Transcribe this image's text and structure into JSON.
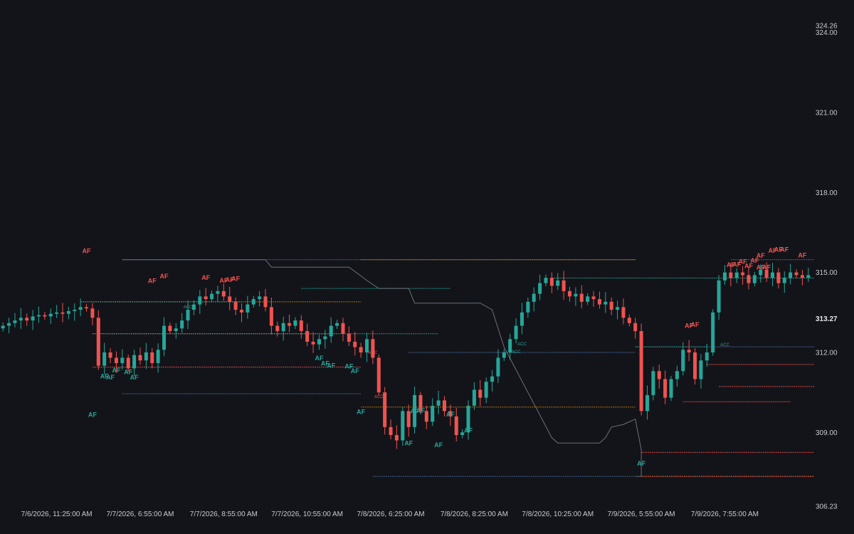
{
  "colors": {
    "background": "#131419",
    "up": "#26a69a",
    "down": "#ef5350",
    "orange": "#c87f0a",
    "blue": "#4a6fa5",
    "gray": "#6b6f78",
    "text": "#c7c9cf"
  },
  "chart_data": {
    "type": "candlestick",
    "title": "",
    "xlabel": "",
    "ylabel": "",
    "ylim": [
      306.23,
      324.26
    ],
    "y_axis": {
      "ticks": [
        "324.26",
        "324.00",
        "321.00",
        "318.00",
        "315.00",
        "312.00",
        "309.00",
        "306.23"
      ],
      "tick_values": [
        324.26,
        324.0,
        321.0,
        318.0,
        315.0,
        312.0,
        309.0,
        306.23
      ],
      "current_price": "313.27"
    },
    "x_axis": {
      "ticks": [
        "7/6/2026, 11:25:00 AM",
        "7/7/2026, 6:55:00 AM",
        "7/7/2026, 8:55:00 AM",
        "7/7/2026, 10:55:00 AM",
        "7/8/2026, 6:25:00 AM",
        "7/8/2026, 8:25:00 AM",
        "7/8/2026, 10:25:00 AM",
        "7/9/2026, 5:55:00 AM",
        "7/9/2026, 7:55:00 AM"
      ],
      "tick_bars": [
        9,
        23,
        37,
        51,
        65,
        79,
        93,
        107,
        121
      ]
    },
    "bar_count": 136,
    "closes": [
      313.0,
      313.1,
      313.2,
      313.3,
      313.2,
      313.35,
      313.4,
      313.35,
      313.45,
      313.5,
      313.45,
      313.55,
      313.6,
      313.7,
      313.65,
      313.3,
      311.5,
      312.0,
      311.8,
      311.6,
      311.8,
      311.4,
      311.9,
      311.7,
      312.0,
      311.6,
      312.1,
      313.0,
      312.8,
      312.9,
      313.2,
      313.6,
      313.8,
      314.1,
      314.0,
      314.2,
      314.3,
      314.1,
      313.9,
      313.6,
      313.5,
      313.8,
      314.0,
      314.1,
      313.7,
      313.0,
      312.8,
      313.1,
      313.0,
      313.2,
      312.8,
      312.4,
      312.3,
      312.5,
      312.6,
      313.0,
      313.1,
      312.7,
      312.4,
      312.2,
      312.0,
      312.5,
      311.8,
      310.5,
      309.2,
      308.9,
      308.7,
      309.8,
      309.2,
      310.4,
      309.8,
      309.4,
      310.0,
      310.2,
      309.8,
      309.6,
      308.9,
      309.0,
      310.0,
      310.6,
      310.3,
      310.9,
      311.1,
      311.8,
      312.0,
      312.5,
      313.0,
      313.5,
      313.9,
      314.2,
      314.6,
      314.8,
      314.5,
      314.7,
      314.3,
      314.1,
      314.2,
      313.9,
      314.1,
      314.0,
      313.8,
      313.9,
      313.6,
      313.7,
      313.3,
      313.1,
      312.8,
      309.8,
      310.4,
      311.3,
      311.0,
      310.3,
      311.0,
      311.3,
      312.1,
      312.0,
      311.0,
      311.7,
      312.0,
      313.5,
      314.7,
      315.0,
      314.8,
      315.0,
      314.9,
      314.6,
      314.9,
      315.1,
      314.8,
      315.0,
      314.6,
      314.8,
      315.0,
      314.9,
      314.8,
      314.9
    ],
    "levels": [
      {
        "price": 315.48,
        "from_bar": 20,
        "to_bar": 106,
        "color": "#4a6fa5"
      },
      {
        "price": 315.48,
        "from_bar": 60,
        "to_bar": 106,
        "color": "#c87f0a"
      },
      {
        "price": 315.48,
        "from_bar": 122,
        "to_bar": 136,
        "color": "#6b6f78"
      },
      {
        "price": 314.79,
        "from_bar": 92,
        "to_bar": 136,
        "color": "#26a69a"
      },
      {
        "price": 314.4,
        "from_bar": 50,
        "to_bar": 75,
        "color": "#26a69a"
      },
      {
        "price": 313.9,
        "from_bar": 13,
        "to_bar": 60,
        "color": "#c87f0a"
      },
      {
        "price": 313.9,
        "from_bar": 13,
        "to_bar": 40,
        "color": "#26a69a"
      },
      {
        "price": 312.7,
        "from_bar": 15,
        "to_bar": 56,
        "color": "#ef5350"
      },
      {
        "price": 312.7,
        "from_bar": 15,
        "to_bar": 73,
        "color": "#26a69a"
      },
      {
        "price": 312.21,
        "from_bar": 106,
        "to_bar": 136,
        "color": "#4a6fa5"
      },
      {
        "price": 312.21,
        "from_bar": 106,
        "to_bar": 118,
        "color": "#26a69a"
      },
      {
        "price": 312.0,
        "from_bar": 68,
        "to_bar": 106,
        "color": "#4a6fa5"
      },
      {
        "price": 311.55,
        "from_bar": 118,
        "to_bar": 136,
        "color": "#ef5350"
      },
      {
        "price": 311.45,
        "from_bar": 15,
        "to_bar": 60,
        "color": "#ef5350"
      },
      {
        "price": 310.72,
        "from_bar": 120,
        "to_bar": 136,
        "color": "#ef5350"
      },
      {
        "price": 310.15,
        "from_bar": 114,
        "to_bar": 132,
        "color": "#ef5350"
      },
      {
        "price": 310.45,
        "from_bar": 20,
        "to_bar": 60,
        "color": "#4a6fa5"
      },
      {
        "price": 309.95,
        "from_bar": 60,
        "to_bar": 106,
        "color": "#c87f0a"
      },
      {
        "price": 308.25,
        "from_bar": 107,
        "to_bar": 136,
        "color": "#ef5350"
      },
      {
        "price": 307.35,
        "from_bar": 62,
        "to_bar": 106,
        "color": "#4a6fa5"
      },
      {
        "price": 307.35,
        "from_bar": 107,
        "to_bar": 136,
        "color": "#c87f0a"
      },
      {
        "price": 307.35,
        "from_bar": 107,
        "to_bar": 136,
        "color": "#ef5350"
      }
    ],
    "step_line": {
      "color": "#6b6f78",
      "points": [
        [
          20,
          315.48
        ],
        [
          44,
          315.48
        ],
        [
          45,
          315.2
        ],
        [
          58,
          315.2
        ],
        [
          61,
          314.7
        ],
        [
          63,
          314.4
        ],
        [
          68,
          314.4
        ],
        [
          69,
          313.85
        ],
        [
          80,
          313.85
        ],
        [
          82,
          313.6
        ],
        [
          84,
          312.2
        ],
        [
          92,
          308.8
        ],
        [
          93,
          308.6
        ],
        [
          100,
          308.6
        ],
        [
          101,
          308.8
        ],
        [
          102,
          309.2
        ],
        [
          104,
          309.3
        ],
        [
          106,
          309.5
        ],
        [
          107,
          308.35
        ],
        [
          107,
          307.35
        ],
        [
          106,
          307.35
        ]
      ]
    },
    "annotations": [
      {
        "text": "AF",
        "bar": 14,
        "price": 315.72,
        "kind": "down"
      },
      {
        "text": "AF",
        "bar": 25,
        "price": 314.6,
        "kind": "down"
      },
      {
        "text": "AF",
        "bar": 27,
        "price": 314.78,
        "kind": "down"
      },
      {
        "text": "AF",
        "bar": 34,
        "price": 314.72,
        "kind": "down"
      },
      {
        "text": "AF",
        "bar": 37,
        "price": 314.62,
        "kind": "down"
      },
      {
        "text": "AF",
        "bar": 38,
        "price": 314.64,
        "kind": "down"
      },
      {
        "text": "AF",
        "bar": 39,
        "price": 314.68,
        "kind": "down"
      },
      {
        "text": "AF",
        "bar": 15,
        "price": 309.58,
        "kind": "up"
      },
      {
        "text": "AF",
        "bar": 17,
        "price": 311.03,
        "kind": "up"
      },
      {
        "text": "AF",
        "bar": 18,
        "price": 310.99,
        "kind": "up"
      },
      {
        "text": "AF",
        "bar": 19,
        "price": 311.25,
        "kind": "up"
      },
      {
        "text": "AF",
        "bar": 21,
        "price": 311.18,
        "kind": "up"
      },
      {
        "text": "AF",
        "bar": 22,
        "price": 310.98,
        "kind": "up"
      },
      {
        "text": "AF",
        "bar": 53,
        "price": 311.7,
        "kind": "up"
      },
      {
        "text": "AF",
        "bar": 54,
        "price": 311.5,
        "kind": "up"
      },
      {
        "text": "AF",
        "bar": 55,
        "price": 311.42,
        "kind": "up"
      },
      {
        "text": "AF",
        "bar": 58,
        "price": 311.4,
        "kind": "up"
      },
      {
        "text": "AF",
        "bar": 59,
        "price": 311.22,
        "kind": "up"
      },
      {
        "text": "AF",
        "bar": 60,
        "price": 309.69,
        "kind": "up"
      },
      {
        "text": "AF",
        "bar": 68,
        "price": 308.52,
        "kind": "up"
      },
      {
        "text": "AF",
        "bar": 69,
        "price": 309.71,
        "kind": "up"
      },
      {
        "text": "AF",
        "bar": 70,
        "price": 309.73,
        "kind": "up"
      },
      {
        "text": "AF",
        "bar": 73,
        "price": 308.45,
        "kind": "up"
      },
      {
        "text": "AF",
        "bar": 75,
        "price": 309.59,
        "kind": "up"
      },
      {
        "text": "AF",
        "bar": 78,
        "price": 309.0,
        "kind": "up"
      },
      {
        "text": "AF",
        "bar": 107,
        "price": 307.75,
        "kind": "up"
      },
      {
        "text": "AF",
        "bar": 115,
        "price": 312.92,
        "kind": "down"
      },
      {
        "text": "AF",
        "bar": 116,
        "price": 312.96,
        "kind": "down"
      },
      {
        "text": "AF",
        "bar": 122,
        "price": 315.2,
        "kind": "down"
      },
      {
        "text": "AF",
        "bar": 123,
        "price": 315.22,
        "kind": "down"
      },
      {
        "text": "AF",
        "bar": 124,
        "price": 315.33,
        "kind": "down"
      },
      {
        "text": "AF",
        "bar": 125,
        "price": 315.16,
        "kind": "down"
      },
      {
        "text": "AF",
        "bar": 126,
        "price": 315.36,
        "kind": "down"
      },
      {
        "text": "AF",
        "bar": 127,
        "price": 315.55,
        "kind": "down"
      },
      {
        "text": "AF",
        "bar": 127,
        "price": 315.11,
        "kind": "down"
      },
      {
        "text": "AF",
        "bar": 128,
        "price": 315.11,
        "kind": "down"
      },
      {
        "text": "AF",
        "bar": 129,
        "price": 315.74,
        "kind": "down"
      },
      {
        "text": "AF",
        "bar": 130,
        "price": 315.78,
        "kind": "down"
      },
      {
        "text": "AF",
        "bar": 131,
        "price": 315.78,
        "kind": "down"
      },
      {
        "text": "AF",
        "bar": 134,
        "price": 315.56,
        "kind": "down"
      },
      {
        "text": "ACC",
        "bar": 31,
        "price": 313.66,
        "kind": "up"
      },
      {
        "text": "ACC",
        "bar": 62,
        "price": 311.94,
        "kind": "down"
      },
      {
        "text": "ACC",
        "bar": 63,
        "price": 310.29,
        "kind": "down"
      },
      {
        "text": "ACC",
        "bar": 87,
        "price": 312.27,
        "kind": "up"
      },
      {
        "text": "ACC",
        "bar": 86,
        "price": 311.97,
        "kind": "up"
      },
      {
        "text": "ACC",
        "bar": 121,
        "price": 312.24,
        "kind": "up"
      }
    ]
  }
}
